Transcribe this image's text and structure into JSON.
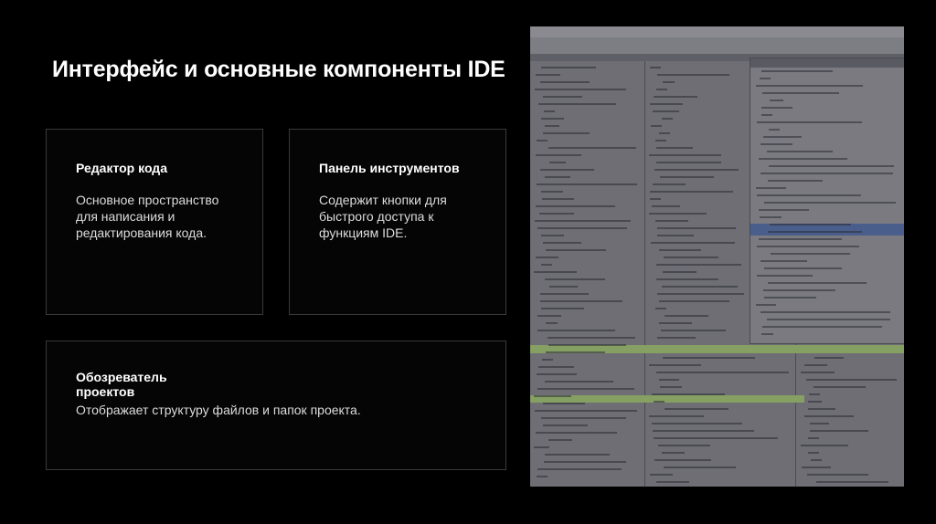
{
  "slide": {
    "title": "Интерфейс и основные компоненты IDE"
  },
  "cards": [
    {
      "title": "Редактор кода",
      "body": "Основное пространство для написания и редактирования кода."
    },
    {
      "title": "Панель инструментов",
      "body": "Содержит кнопки для быстрого доступа к функциям IDE."
    },
    {
      "title": "Обозреватель проектов",
      "body": "Отображает структуру файлов и папок проекта."
    }
  ],
  "colors": {
    "background": "#000000",
    "card_border": "#3a3a3a",
    "text": "#ffffff",
    "body_text": "#dcdcdc",
    "screenshot_gray": "#6e6e74",
    "highlight_green": "#86a064",
    "selection_blue": "#4a5e8c"
  }
}
